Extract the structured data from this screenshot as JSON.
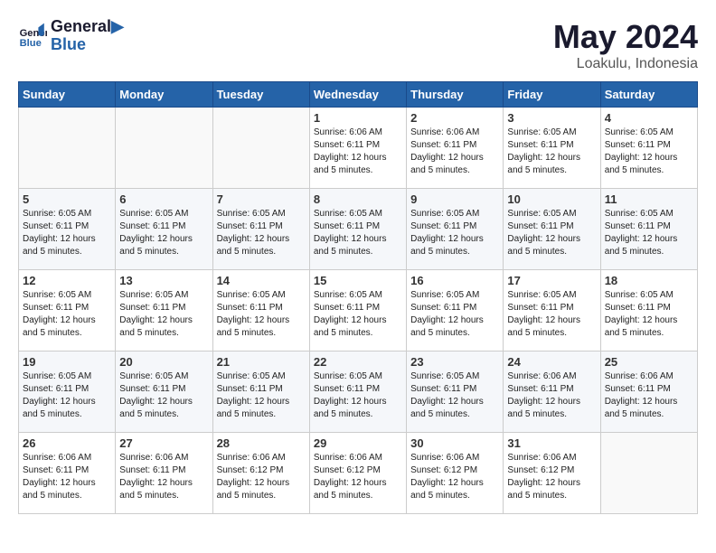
{
  "logo": {
    "text_general": "General",
    "text_blue": "Blue"
  },
  "title": {
    "month_year": "May 2024",
    "location": "Loakulu, Indonesia"
  },
  "weekdays": [
    "Sunday",
    "Monday",
    "Tuesday",
    "Wednesday",
    "Thursday",
    "Friday",
    "Saturday"
  ],
  "weeks": [
    [
      {
        "day": null
      },
      {
        "day": null
      },
      {
        "day": null
      },
      {
        "day": "1",
        "sunrise": "Sunrise: 6:06 AM",
        "sunset": "Sunset: 6:11 PM",
        "daylight": "Daylight: 12 hours and 5 minutes."
      },
      {
        "day": "2",
        "sunrise": "Sunrise: 6:06 AM",
        "sunset": "Sunset: 6:11 PM",
        "daylight": "Daylight: 12 hours and 5 minutes."
      },
      {
        "day": "3",
        "sunrise": "Sunrise: 6:05 AM",
        "sunset": "Sunset: 6:11 PM",
        "daylight": "Daylight: 12 hours and 5 minutes."
      },
      {
        "day": "4",
        "sunrise": "Sunrise: 6:05 AM",
        "sunset": "Sunset: 6:11 PM",
        "daylight": "Daylight: 12 hours and 5 minutes."
      }
    ],
    [
      {
        "day": "5",
        "sunrise": "Sunrise: 6:05 AM",
        "sunset": "Sunset: 6:11 PM",
        "daylight": "Daylight: 12 hours and 5 minutes."
      },
      {
        "day": "6",
        "sunrise": "Sunrise: 6:05 AM",
        "sunset": "Sunset: 6:11 PM",
        "daylight": "Daylight: 12 hours and 5 minutes."
      },
      {
        "day": "7",
        "sunrise": "Sunrise: 6:05 AM",
        "sunset": "Sunset: 6:11 PM",
        "daylight": "Daylight: 12 hours and 5 minutes."
      },
      {
        "day": "8",
        "sunrise": "Sunrise: 6:05 AM",
        "sunset": "Sunset: 6:11 PM",
        "daylight": "Daylight: 12 hours and 5 minutes."
      },
      {
        "day": "9",
        "sunrise": "Sunrise: 6:05 AM",
        "sunset": "Sunset: 6:11 PM",
        "daylight": "Daylight: 12 hours and 5 minutes."
      },
      {
        "day": "10",
        "sunrise": "Sunrise: 6:05 AM",
        "sunset": "Sunset: 6:11 PM",
        "daylight": "Daylight: 12 hours and 5 minutes."
      },
      {
        "day": "11",
        "sunrise": "Sunrise: 6:05 AM",
        "sunset": "Sunset: 6:11 PM",
        "daylight": "Daylight: 12 hours and 5 minutes."
      }
    ],
    [
      {
        "day": "12",
        "sunrise": "Sunrise: 6:05 AM",
        "sunset": "Sunset: 6:11 PM",
        "daylight": "Daylight: 12 hours and 5 minutes."
      },
      {
        "day": "13",
        "sunrise": "Sunrise: 6:05 AM",
        "sunset": "Sunset: 6:11 PM",
        "daylight": "Daylight: 12 hours and 5 minutes."
      },
      {
        "day": "14",
        "sunrise": "Sunrise: 6:05 AM",
        "sunset": "Sunset: 6:11 PM",
        "daylight": "Daylight: 12 hours and 5 minutes."
      },
      {
        "day": "15",
        "sunrise": "Sunrise: 6:05 AM",
        "sunset": "Sunset: 6:11 PM",
        "daylight": "Daylight: 12 hours and 5 minutes."
      },
      {
        "day": "16",
        "sunrise": "Sunrise: 6:05 AM",
        "sunset": "Sunset: 6:11 PM",
        "daylight": "Daylight: 12 hours and 5 minutes."
      },
      {
        "day": "17",
        "sunrise": "Sunrise: 6:05 AM",
        "sunset": "Sunset: 6:11 PM",
        "daylight": "Daylight: 12 hours and 5 minutes."
      },
      {
        "day": "18",
        "sunrise": "Sunrise: 6:05 AM",
        "sunset": "Sunset: 6:11 PM",
        "daylight": "Daylight: 12 hours and 5 minutes."
      }
    ],
    [
      {
        "day": "19",
        "sunrise": "Sunrise: 6:05 AM",
        "sunset": "Sunset: 6:11 PM",
        "daylight": "Daylight: 12 hours and 5 minutes."
      },
      {
        "day": "20",
        "sunrise": "Sunrise: 6:05 AM",
        "sunset": "Sunset: 6:11 PM",
        "daylight": "Daylight: 12 hours and 5 minutes."
      },
      {
        "day": "21",
        "sunrise": "Sunrise: 6:05 AM",
        "sunset": "Sunset: 6:11 PM",
        "daylight": "Daylight: 12 hours and 5 minutes."
      },
      {
        "day": "22",
        "sunrise": "Sunrise: 6:05 AM",
        "sunset": "Sunset: 6:11 PM",
        "daylight": "Daylight: 12 hours and 5 minutes."
      },
      {
        "day": "23",
        "sunrise": "Sunrise: 6:05 AM",
        "sunset": "Sunset: 6:11 PM",
        "daylight": "Daylight: 12 hours and 5 minutes."
      },
      {
        "day": "24",
        "sunrise": "Sunrise: 6:06 AM",
        "sunset": "Sunset: 6:11 PM",
        "daylight": "Daylight: 12 hours and 5 minutes."
      },
      {
        "day": "25",
        "sunrise": "Sunrise: 6:06 AM",
        "sunset": "Sunset: 6:11 PM",
        "daylight": "Daylight: 12 hours and 5 minutes."
      }
    ],
    [
      {
        "day": "26",
        "sunrise": "Sunrise: 6:06 AM",
        "sunset": "Sunset: 6:11 PM",
        "daylight": "Daylight: 12 hours and 5 minutes."
      },
      {
        "day": "27",
        "sunrise": "Sunrise: 6:06 AM",
        "sunset": "Sunset: 6:11 PM",
        "daylight": "Daylight: 12 hours and 5 minutes."
      },
      {
        "day": "28",
        "sunrise": "Sunrise: 6:06 AM",
        "sunset": "Sunset: 6:12 PM",
        "daylight": "Daylight: 12 hours and 5 minutes."
      },
      {
        "day": "29",
        "sunrise": "Sunrise: 6:06 AM",
        "sunset": "Sunset: 6:12 PM",
        "daylight": "Daylight: 12 hours and 5 minutes."
      },
      {
        "day": "30",
        "sunrise": "Sunrise: 6:06 AM",
        "sunset": "Sunset: 6:12 PM",
        "daylight": "Daylight: 12 hours and 5 minutes."
      },
      {
        "day": "31",
        "sunrise": "Sunrise: 6:06 AM",
        "sunset": "Sunset: 6:12 PM",
        "daylight": "Daylight: 12 hours and 5 minutes."
      },
      {
        "day": null
      }
    ]
  ]
}
